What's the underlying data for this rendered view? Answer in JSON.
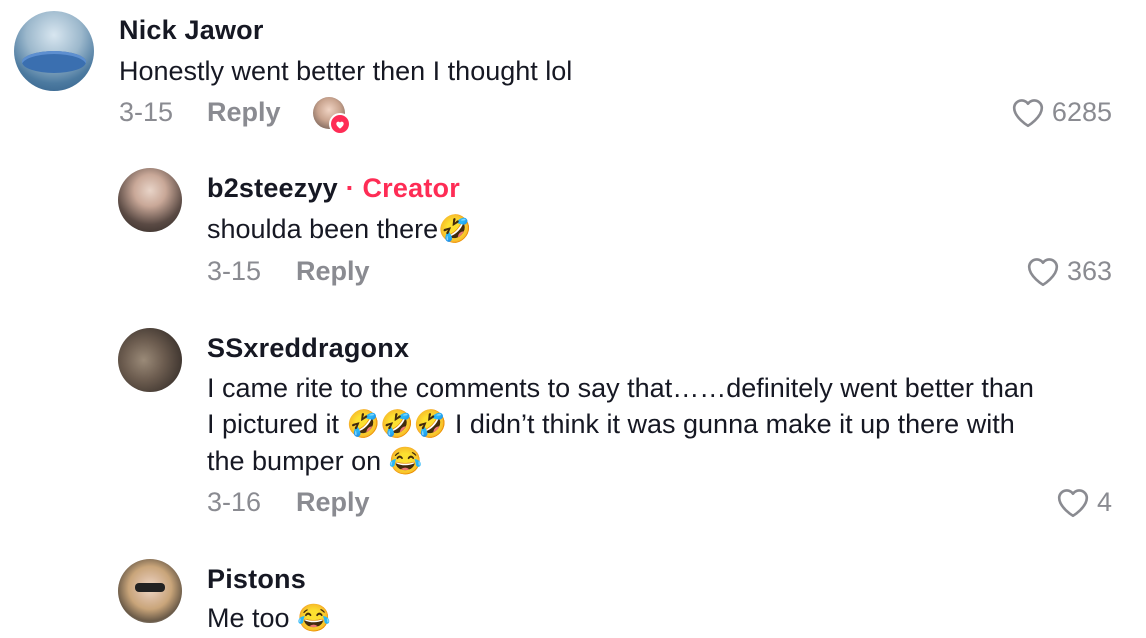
{
  "comments": [
    {
      "username": "Nick Jawor",
      "text": "Honestly went better then I thought lol",
      "date": "3-15",
      "reply_label": "Reply",
      "likes": "6285",
      "creator_liked": true
    }
  ],
  "replies": [
    {
      "username": "b2steezyy",
      "badge": "· Creator",
      "text": "shoulda been there🤣",
      "date": "3-15",
      "reply_label": "Reply",
      "likes": "363"
    },
    {
      "username": "SSxreddragonx",
      "text_lines": [
        "I came rite to the comments to say that……definitely went better than",
        "I pictured it 🤣🤣🤣 I didn’t think it was gunna make it up there with",
        "the bumper on 😂"
      ],
      "date": "3-16",
      "reply_label": "Reply",
      "likes": "4"
    },
    {
      "username": "Pistons",
      "text": "Me too 😂"
    }
  ],
  "icons": {
    "like": "heart-outline-icon",
    "creator_like": "heart-filled-icon"
  },
  "colors": {
    "text": "#161823",
    "muted": "#8a8b91",
    "creator_accent": "#fe2c55"
  }
}
